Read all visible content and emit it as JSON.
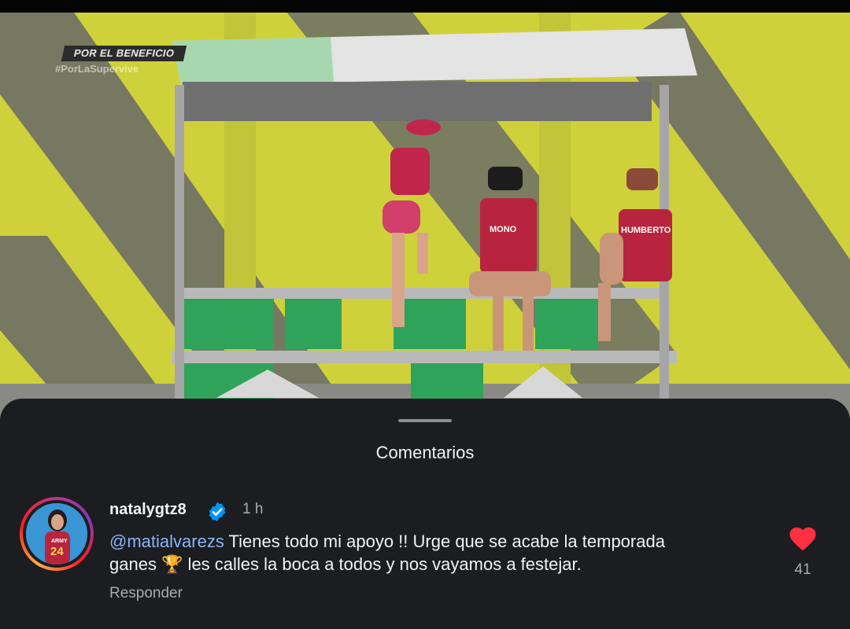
{
  "video": {
    "overlay_label": "POR EL BENEFICIO",
    "overlay_hashtag": "#PorLaSupervive",
    "jersey_names": [
      "MONO",
      "HUMBERTO"
    ],
    "jersey_number": "24",
    "jersey_crest": "ARMY"
  },
  "sheet": {
    "title": "Comentarios"
  },
  "comment": {
    "username": "natalygtz8",
    "time": "1 h",
    "mention": "@matialvarezs",
    "text_line1": " Tienes todo mi apoyo !! Urge que se acabe la temporada",
    "text_line2": "ganes 🏆 les calles la boca  a todos  y nos vayamos a festejar.",
    "reply_label": "Responder",
    "like_count": "41",
    "liked": true,
    "icons": {
      "verified": "verified-badge-icon",
      "heart": "heart-filled-icon"
    },
    "colors": {
      "heart": "#ff3040",
      "verified": "#0095f6",
      "mention": "#8ab4f8"
    }
  }
}
